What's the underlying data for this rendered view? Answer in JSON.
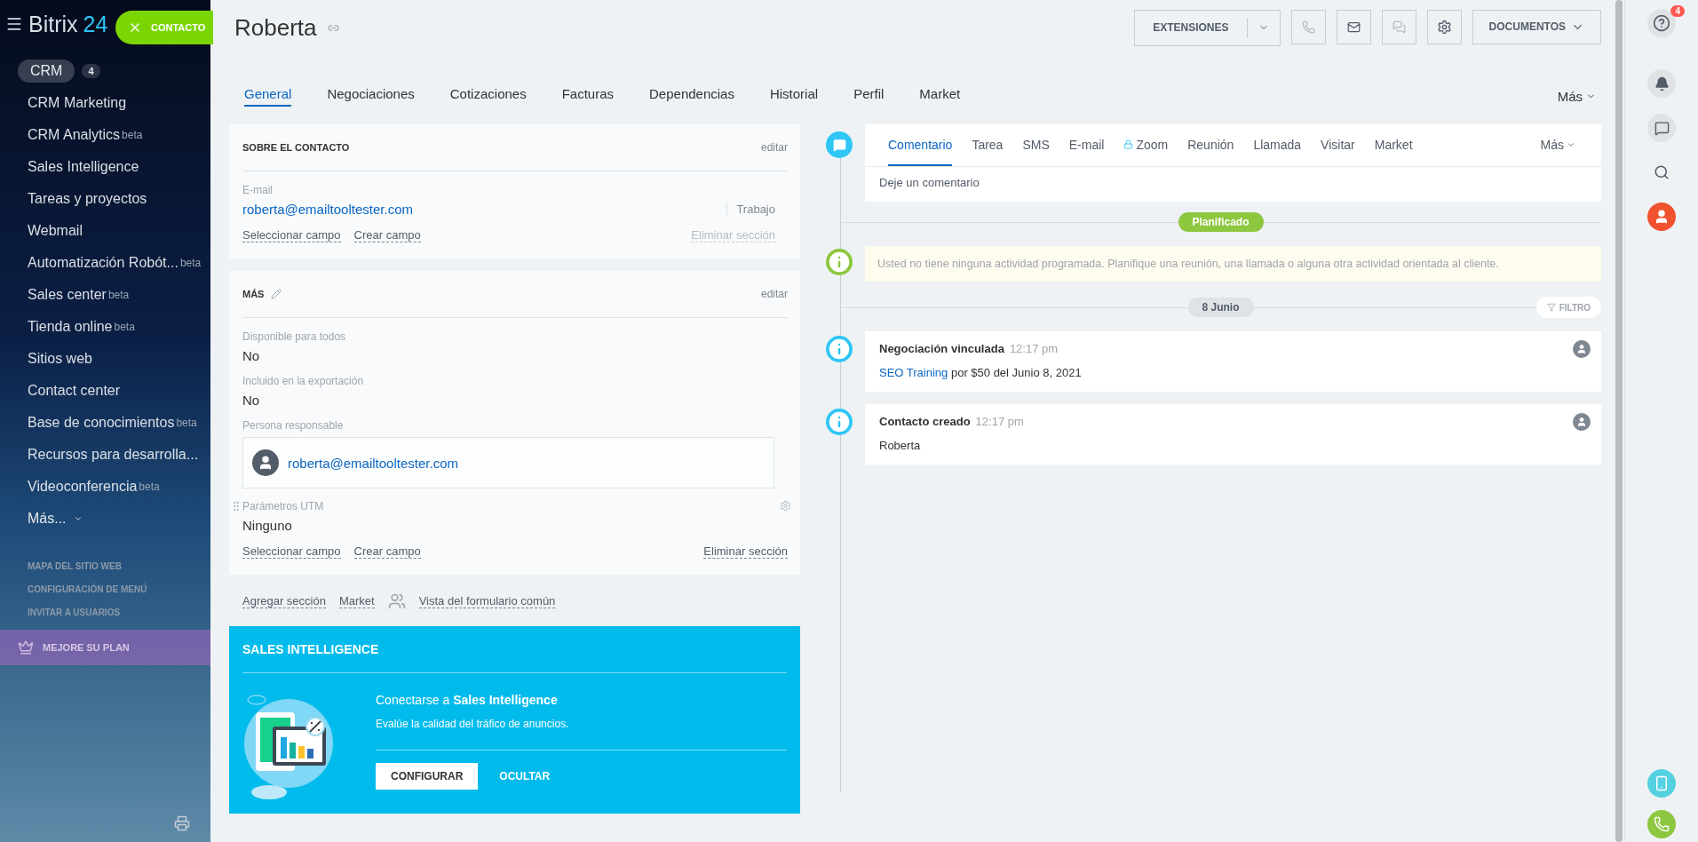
{
  "brand": {
    "name": "Bitrix",
    "suffix": "24",
    "entity_button": "CONTACTO"
  },
  "sidebar": {
    "items": [
      {
        "label": "CRM",
        "count": "4",
        "selected": true
      },
      {
        "label": "CRM Marketing",
        "selected": false
      },
      {
        "label": "CRM Analytics",
        "beta": "beta",
        "selected": false
      },
      {
        "label": "Sales Intelligence",
        "selected": false
      },
      {
        "label": "Tareas y proyectos",
        "selected": false
      },
      {
        "label": "Webmail",
        "selected": false
      },
      {
        "label": "Automatización Robót...",
        "beta": "beta",
        "selected": false
      },
      {
        "label": "Sales center",
        "beta": "beta",
        "selected": false
      },
      {
        "label": "Tienda online",
        "beta": "beta",
        "selected": false
      },
      {
        "label": "Sitios web",
        "selected": false
      },
      {
        "label": "Contact center",
        "selected": false
      },
      {
        "label": "Base de conocimientos",
        "beta": "beta",
        "selected": false
      },
      {
        "label": "Recursos para desarrolla...",
        "selected": false
      },
      {
        "label": "Videoconferencia",
        "beta": "beta",
        "selected": false
      }
    ],
    "more": "Más...",
    "links": [
      "MAPA DEL SITIO WEB",
      "CONFIGURACIÓN DE MENÚ",
      "INVITAR A USUARIOS"
    ],
    "upgrade": "MEJORE SU PLAN"
  },
  "title": "Roberta",
  "toolbar": {
    "extensions": "EXTENSIONES",
    "documents": "DOCUMENTOS"
  },
  "tabs": [
    {
      "label": "General",
      "selected": true
    },
    {
      "label": "Negociaciones",
      "selected": false
    },
    {
      "label": "Cotizaciones",
      "selected": false
    },
    {
      "label": "Facturas",
      "selected": false
    },
    {
      "label": "Dependencias",
      "selected": false
    },
    {
      "label": "Historial",
      "selected": false
    },
    {
      "label": "Perfil",
      "selected": false
    },
    {
      "label": "Market",
      "selected": false
    }
  ],
  "tabs_more": "Más",
  "sections": [
    {
      "title": "SOBRE EL CONTACTO",
      "pencil": false,
      "edit": "editar",
      "fields": [
        {
          "kind": "email",
          "label": "E-mail",
          "value": "roberta@emailtooltester.com",
          "type": "Trabajo"
        }
      ],
      "actions": [
        "Seleccionar campo",
        "Crear campo"
      ],
      "delete": "Eliminar sección",
      "delete_disabled": true
    },
    {
      "title": "MÁS",
      "pencil": true,
      "edit": "editar",
      "fields": [
        {
          "kind": "text",
          "label": "Disponible para todos",
          "value": "No"
        },
        {
          "kind": "text",
          "label": "Incluido en la exportación",
          "value": "No"
        },
        {
          "kind": "user",
          "label": "Persona responsable",
          "value": "roberta@emailtooltester.com"
        },
        {
          "kind": "setting",
          "label": "Parámetros UTM",
          "value": "Ninguno"
        }
      ],
      "actions": [
        "Seleccionar campo",
        "Crear campo"
      ],
      "delete": "Eliminar sección",
      "delete_disabled": false
    }
  ],
  "footer_links": [
    "Agregar sección",
    "Market",
    "Vista del formulario común"
  ],
  "promo": {
    "title": "SALES INTELLIGENCE",
    "heading": "Conectarse a **Sales Intelligence**",
    "text": "Evalúe la calidad del tráfico de anuncios.",
    "primary": "CONFIGURAR",
    "secondary": "OCULTAR"
  },
  "timeline": {
    "tabs": [
      {
        "label": "Comentario",
        "selected": true,
        "locked": false
      },
      {
        "label": "Tarea",
        "selected": false,
        "locked": false
      },
      {
        "label": "SMS",
        "selected": false,
        "locked": false
      },
      {
        "label": "E-mail",
        "selected": false,
        "locked": false
      },
      {
        "label": "Zoom",
        "selected": false,
        "locked": true
      },
      {
        "label": "Reunión",
        "selected": false,
        "locked": false
      },
      {
        "label": "Llamada",
        "selected": false,
        "locked": false
      },
      {
        "label": "Visitar",
        "selected": false,
        "locked": false
      },
      {
        "label": "Market",
        "selected": false,
        "locked": false
      }
    ],
    "more": "Más",
    "placeholder": "Deje un comentario",
    "planned": "Planificado",
    "notice": "Usted no tiene ninguna actividad programada. Planifique una reunión, una llamada o alguna otra actividad orientada al cliente.",
    "date": "8 Junio",
    "filter": "FILTRO",
    "events": [
      {
        "title": "Negociación vinculada",
        "time": "12:17 pm",
        "link": "SEO Training",
        "text": " por $50 del Junio 8, 2021"
      },
      {
        "title": "Contacto creado",
        "time": "12:17 pm",
        "text": "Roberta"
      }
    ]
  },
  "rightbar": {
    "help_count": "4"
  }
}
